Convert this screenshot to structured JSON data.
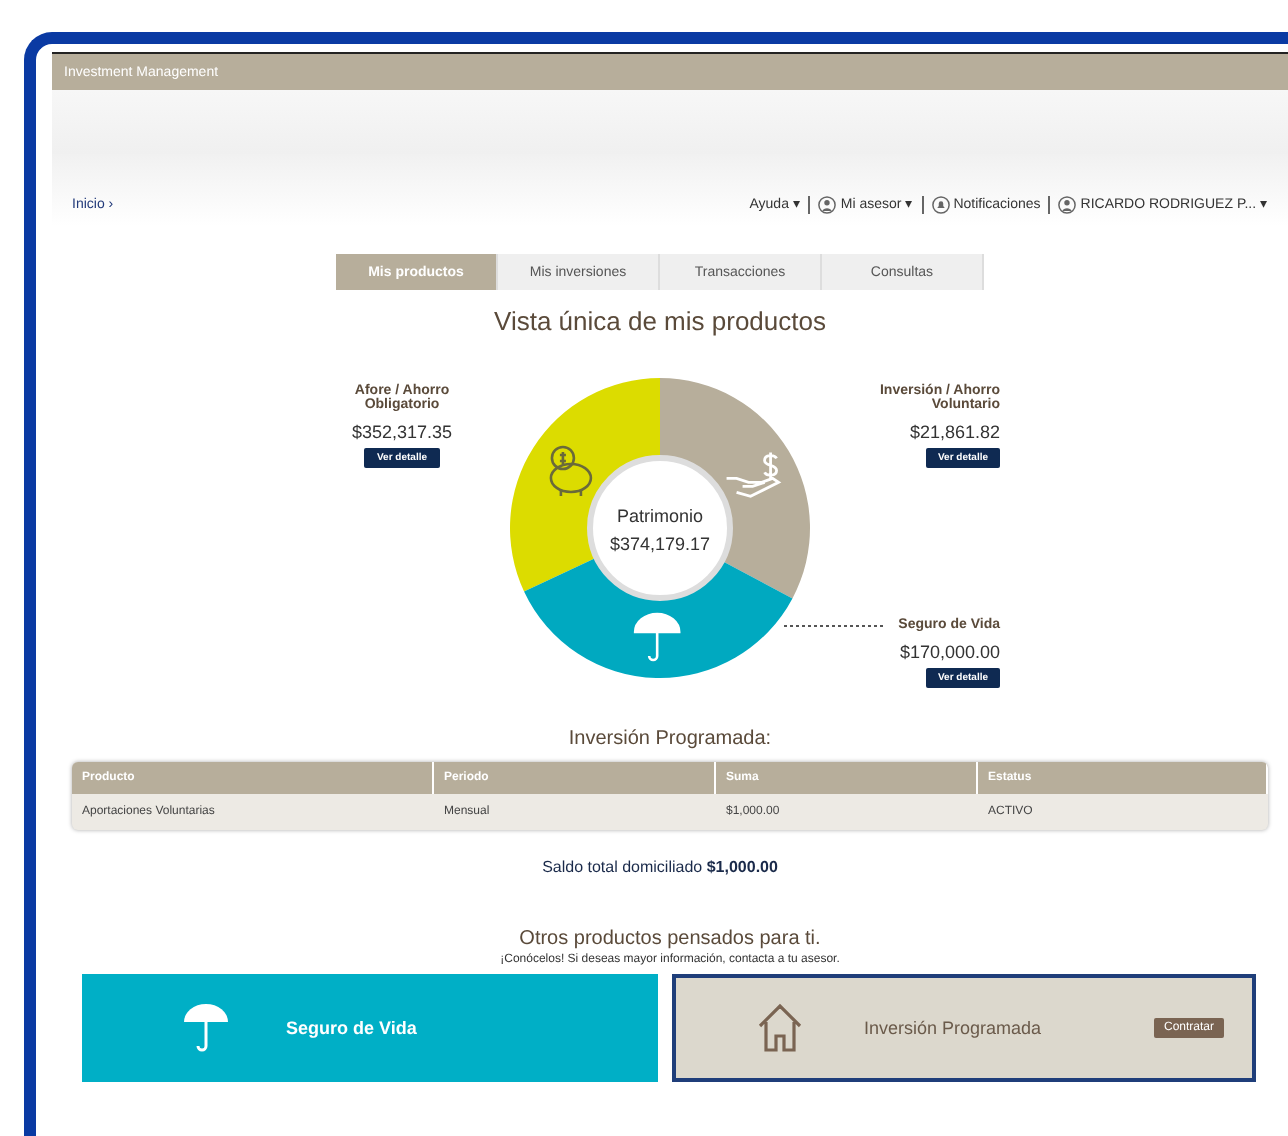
{
  "header": {
    "title": "Investment Management"
  },
  "breadcrumb": "Inicio ›",
  "user_menu": [
    {
      "kind": "plain",
      "label": "Ayuda ▾"
    },
    {
      "kind": "person",
      "label": "Mi asesor ▾"
    },
    {
      "kind": "notification",
      "label": "Notificaciones"
    },
    {
      "kind": "person",
      "label": "RICARDO RODRIGUEZ P... ▾"
    }
  ],
  "tabs": [
    {
      "label": "Mis productos",
      "selected": true
    },
    {
      "label": "Mis inversiones",
      "selected": false
    },
    {
      "label": "Transacciones",
      "selected": false
    },
    {
      "label": "Consultas",
      "selected": false
    }
  ],
  "overview": {
    "title": "Vista única de mis productos",
    "center_label": "Patrimonio",
    "center_amount": "$374,179.17",
    "products": [
      {
        "kind": "savings",
        "label": "Afore / Ahorro Obligatorio",
        "amount": "$352,317.35",
        "button": "Ver detalle",
        "color": "#dcdc00"
      },
      {
        "kind": "investment",
        "label": "Inversión / Ahorro Voluntario",
        "amount": "$21,861.82",
        "button": "Ver detalle",
        "color": "#b7ae9b"
      },
      {
        "kind": "insurance",
        "label": "Seguro de Vida",
        "amount": "$170,000.00",
        "button": "Ver detalle",
        "color": "#00a9c0"
      }
    ]
  },
  "scheduled": {
    "title": "Inversión Programada:",
    "columns": [
      "Producto",
      "Periodo",
      "Suma",
      "Estatus"
    ],
    "rows": [
      [
        "Aportaciones Voluntarias",
        "Mensual",
        "$1,000.00",
        "ACTIVO"
      ]
    ],
    "total": "Saldo total domiciliado **$1,000.00**"
  },
  "offers": {
    "title": "Otros productos pensados para ti.",
    "subtitle": "¡Conócelos! Si deseas mayor información, contacta a tu asesor.",
    "cards": [
      {
        "kind": "insurance",
        "label": "Seguro de Vida",
        "selected": false
      },
      {
        "kind": "investment",
        "label": "Inversión Programada",
        "button": "Contratar",
        "selected": true
      }
    ]
  }
}
